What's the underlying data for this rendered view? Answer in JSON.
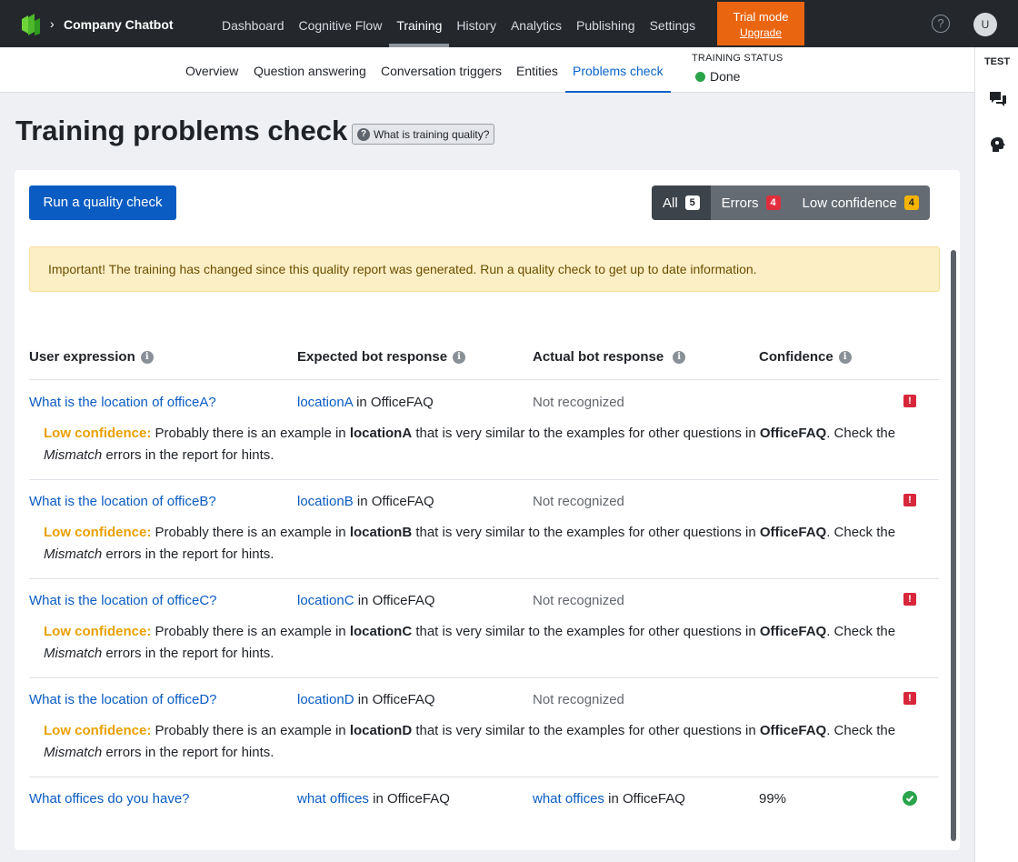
{
  "app": {
    "name": "Company Chatbot"
  },
  "nav": {
    "items": [
      {
        "label": "Dashboard",
        "active": false
      },
      {
        "label": "Cognitive Flow",
        "active": false
      },
      {
        "label": "Training",
        "active": true
      },
      {
        "label": "History",
        "active": false
      },
      {
        "label": "Analytics",
        "active": false
      },
      {
        "label": "Publishing",
        "active": false
      },
      {
        "label": "Settings",
        "active": false
      }
    ],
    "trial": {
      "title": "Trial mode",
      "link": "Upgrade"
    },
    "help_glyph": "?",
    "avatar_initial": "U"
  },
  "subnav": {
    "tabs": [
      {
        "label": "Overview"
      },
      {
        "label": "Question answering"
      },
      {
        "label": "Conversation triggers"
      },
      {
        "label": "Entities"
      },
      {
        "label": "Problems check",
        "active": true
      }
    ],
    "status_label": "TRAINING STATUS",
    "status_value": "Done"
  },
  "rail": {
    "test_label": "TEST"
  },
  "page": {
    "title": "Training problems check",
    "help_button": "What is training quality?"
  },
  "toolbar": {
    "run_button": "Run a quality check",
    "filters": [
      {
        "label": "All",
        "count": "5",
        "active": true
      },
      {
        "label": "Errors",
        "count": "4"
      },
      {
        "label": "Low confidence",
        "count": "4"
      }
    ]
  },
  "warning": "Important! The training has changed since this quality report was generated. Run a quality check to get up to date information.",
  "table": {
    "headers": {
      "user_expression": "User expression",
      "expected": "Expected bot response",
      "actual": "Actual bot response",
      "confidence": "Confidence"
    },
    "in_word": "in",
    "rows": [
      {
        "expression": "What is the location of officeA?",
        "expected_intent": "locationA",
        "expected_group": "OfficeFAQ",
        "actual": "Not recognized",
        "note": {
          "label": "Low confidence:",
          "pre": "Probably there is an example in",
          "intent": "locationA",
          "mid": "that is very similar to the examples for other questions in",
          "group": "OfficeFAQ",
          "post": ". Check the",
          "em": "Mismatch",
          "tail": "errors in the report for hints."
        }
      },
      {
        "expression": "What is the location of officeB?",
        "expected_intent": "locationB",
        "expected_group": "OfficeFAQ",
        "actual": "Not recognized",
        "note": {
          "label": "Low confidence:",
          "pre": "Probably there is an example in",
          "intent": "locationB",
          "mid": "that is very similar to the examples for other questions in",
          "group": "OfficeFAQ",
          "post": ". Check the",
          "em": "Mismatch",
          "tail": "errors in the report for hints."
        }
      },
      {
        "expression": "What is the location of officeC?",
        "expected_intent": "locationC",
        "expected_group": "OfficeFAQ",
        "actual": "Not recognized",
        "note": {
          "label": "Low confidence:",
          "pre": "Probably there is an example in",
          "intent": "locationC",
          "mid": "that is very similar to the examples for other questions in",
          "group": "OfficeFAQ",
          "post": ". Check the",
          "em": "Mismatch",
          "tail": "errors in the report for hints."
        }
      },
      {
        "expression": "What is the location of officeD?",
        "expected_intent": "locationD",
        "expected_group": "OfficeFAQ",
        "actual": "Not recognized",
        "note": {
          "label": "Low confidence:",
          "pre": "Probably there is an example in",
          "intent": "locationD",
          "mid": "that is very similar to the examples for other questions in",
          "group": "OfficeFAQ",
          "post": ". Check the",
          "em": "Mismatch",
          "tail": "errors in the report for hints."
        }
      },
      {
        "expression": "What offices do you have?",
        "expected_intent": "what offices",
        "expected_group": "OfficeFAQ",
        "actual_intent": "what offices",
        "actual_group": "OfficeFAQ",
        "confidence": "99%"
      }
    ]
  },
  "colors": {
    "accent": "#0a5cc2",
    "trial": "#e96510",
    "error": "#d8263a",
    "success": "#2aa34a",
    "low_confidence": "#e9a000",
    "warning_bg": "#fcefc6"
  }
}
